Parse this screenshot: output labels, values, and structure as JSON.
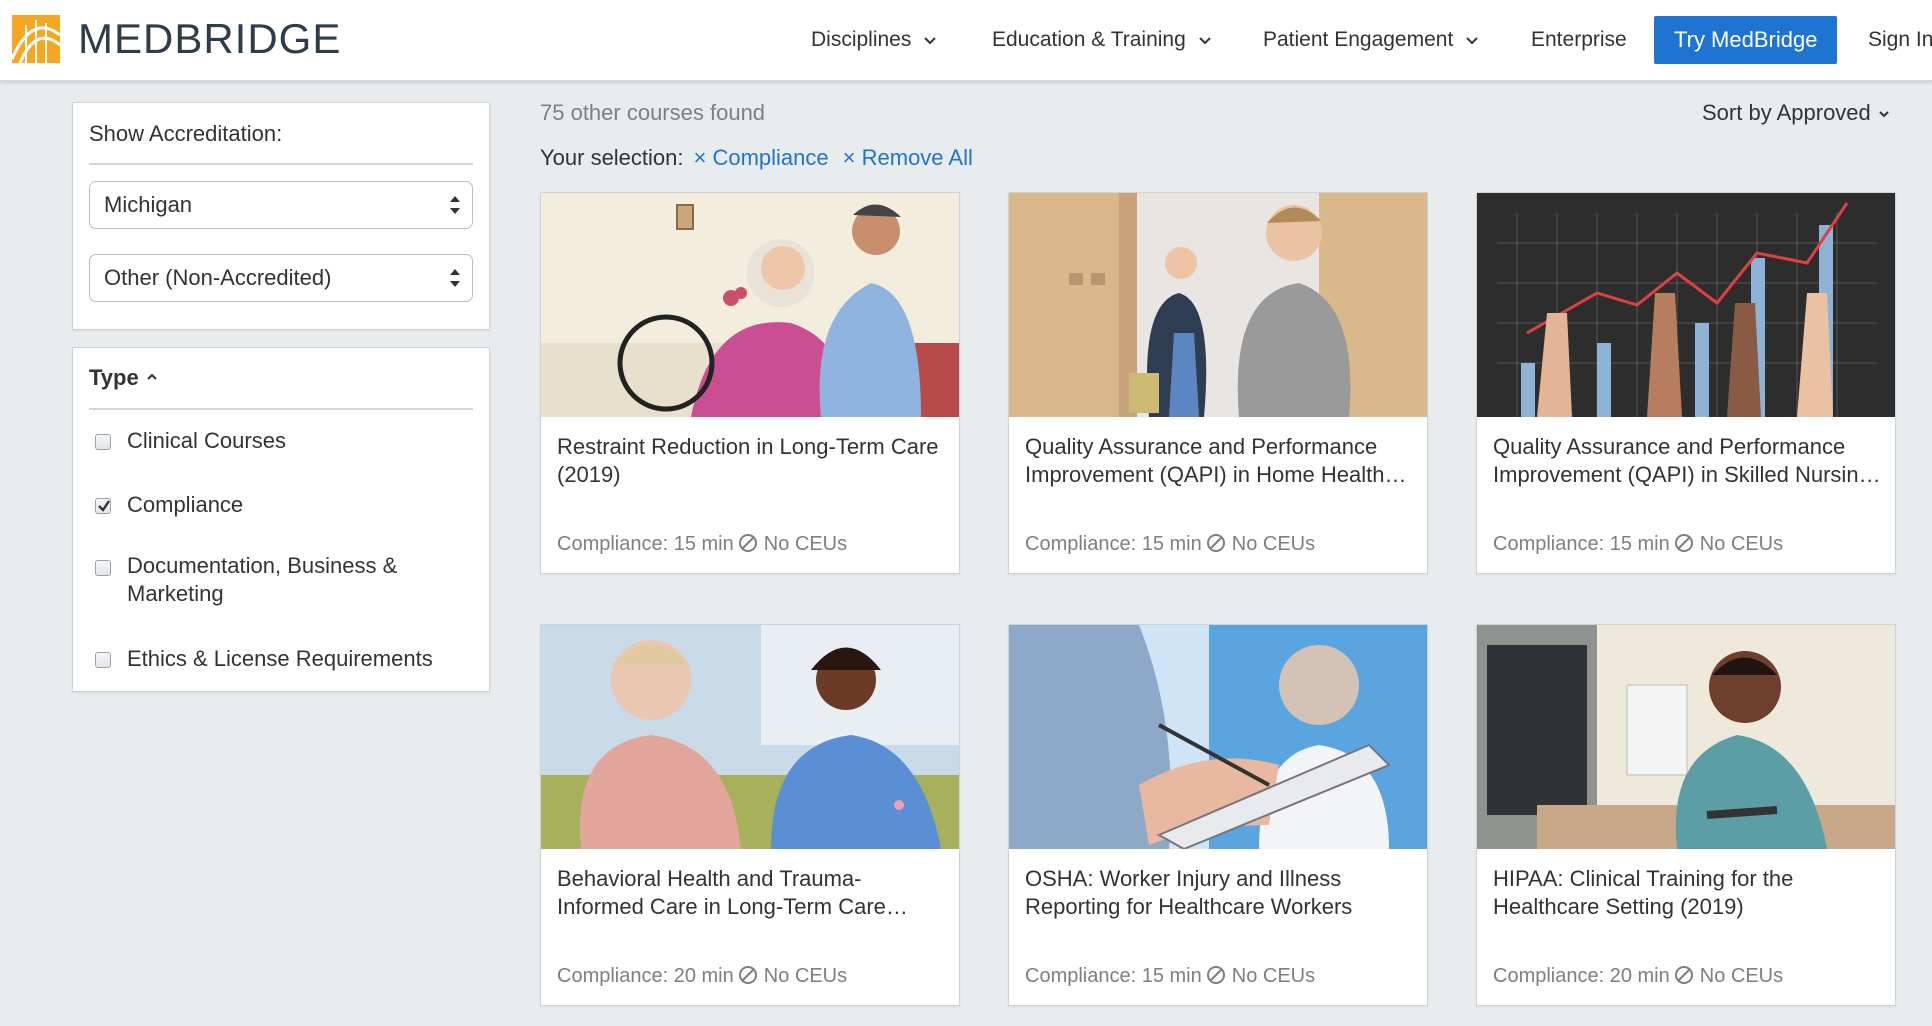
{
  "header": {
    "logo_text": "MEDBRIDGE",
    "nav": [
      {
        "label": "Disciplines",
        "dropdown": true
      },
      {
        "label": "Education & Training",
        "dropdown": true
      },
      {
        "label": "Patient Engagement",
        "dropdown": true
      },
      {
        "label": "Enterprise",
        "dropdown": false
      }
    ],
    "cta_label": "Try MedBridge",
    "sign_in": "Sign In"
  },
  "sidebar": {
    "accreditation": {
      "title": "Show Accreditation:",
      "state_select": "Michigan",
      "accreditor_select": "Other (Non-Accredited)"
    },
    "type": {
      "title": "Type",
      "options": [
        {
          "label": "Clinical Courses",
          "checked": false
        },
        {
          "label": "Compliance",
          "checked": true
        },
        {
          "label": "Documentation, Business & Marketing",
          "checked": false
        },
        {
          "label": "Ethics & License Requirements",
          "checked": false
        }
      ]
    }
  },
  "main": {
    "results_count": "75 other courses found",
    "sort_label": "Sort by Approved",
    "selection_label": "Your selection:",
    "chips": [
      "× Compliance",
      "× Remove All"
    ],
    "courses": [
      {
        "title": "Restraint Reduction in Long-Term Care (2019)",
        "meta_time": "Compliance: 15 min",
        "meta_ceu": "No CEUs"
      },
      {
        "title": "Quality Assurance and Performance Improvement (QAPI) in Home Health Care",
        "meta_time": "Compliance: 15 min",
        "meta_ceu": "No CEUs"
      },
      {
        "title": "Quality Assurance and Performance Improvement (QAPI) in Skilled Nursing Facilities",
        "meta_time": "Compliance: 15 min",
        "meta_ceu": "No CEUs"
      },
      {
        "title": "Behavioral Health and Trauma-Informed Care in Long-Term Care Settings",
        "meta_time": "Compliance: 20 min",
        "meta_ceu": "No CEUs"
      },
      {
        "title": "OSHA: Worker Injury and Illness Reporting for Healthcare Workers",
        "meta_time": "Compliance: 15 min",
        "meta_ceu": "No CEUs"
      },
      {
        "title": "HIPAA: Clinical Training for the Healthcare Setting (2019)",
        "meta_time": "Compliance: 20 min",
        "meta_ceu": "No CEUs"
      }
    ]
  },
  "colors": {
    "brand_blue": "#1f74d2",
    "logo_orange": "#f5a623",
    "logo_text": "#2f3c4c",
    "page_bg": "#e9ecee"
  },
  "icons": [
    "logo-mark-icon",
    "chevron-down-icon",
    "select-updown-icon",
    "checkmark-icon",
    "chevron-up-icon",
    "no-ceu-icon"
  ]
}
